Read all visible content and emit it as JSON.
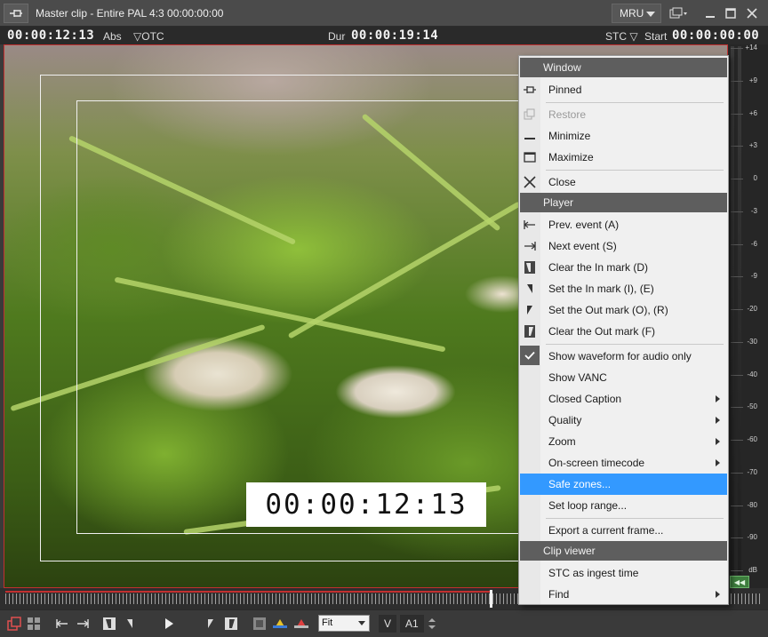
{
  "window": {
    "title": "Master clip - Entire PAL 4:3 00:00:00:00",
    "mru_label": "MRU"
  },
  "timecode_bar": {
    "current_tc": "00:00:12:13",
    "current_mode": "Abs",
    "otc_label": "OTC",
    "dur_label": "Dur",
    "duration_tc": "00:00:19:14",
    "stc_label": "STC",
    "start_label": "Start",
    "start_tc": "00:00:00:00"
  },
  "video": {
    "osd_timecode": "00:00:12:13"
  },
  "meter": {
    "scale": [
      "+14",
      "+9",
      "+6",
      "+3",
      "0",
      "-3",
      "-6",
      "-9",
      "-20",
      "-30",
      "-40",
      "-50",
      "-60",
      "-70",
      "-80",
      "-90",
      "dB"
    ]
  },
  "timeline": {
    "progress_fraction": 0.64
  },
  "toolbar": {
    "fit_value": "Fit",
    "v_label": "V",
    "a_label": "A1"
  },
  "menu": {
    "sections": {
      "window": "Window",
      "player": "Player",
      "clip_viewer": "Clip viewer"
    },
    "items": {
      "pinned": "Pinned",
      "restore": "Restore",
      "minimize": "Minimize",
      "maximize": "Maximize",
      "close": "Close",
      "prev_event": "Prev. event (A)",
      "next_event": "Next event (S)",
      "clear_in": "Clear the In mark (D)",
      "set_in": "Set the In mark (I), (E)",
      "set_out": "Set the Out mark (O), (R)",
      "clear_out": "Clear the Out mark (F)",
      "show_waveform": "Show waveform for audio only",
      "show_vanc": "Show VANC",
      "closed_caption": "Closed Caption",
      "quality": "Quality",
      "zoom": "Zoom",
      "onscreen_tc": "On-screen timecode",
      "safe_zones": "Safe zones...",
      "set_loop": "Set loop range...",
      "export_frame": "Export a current frame...",
      "stc_ingest": "STC as ingest time",
      "find": "Find"
    },
    "highlight_color": "#3399ff"
  }
}
